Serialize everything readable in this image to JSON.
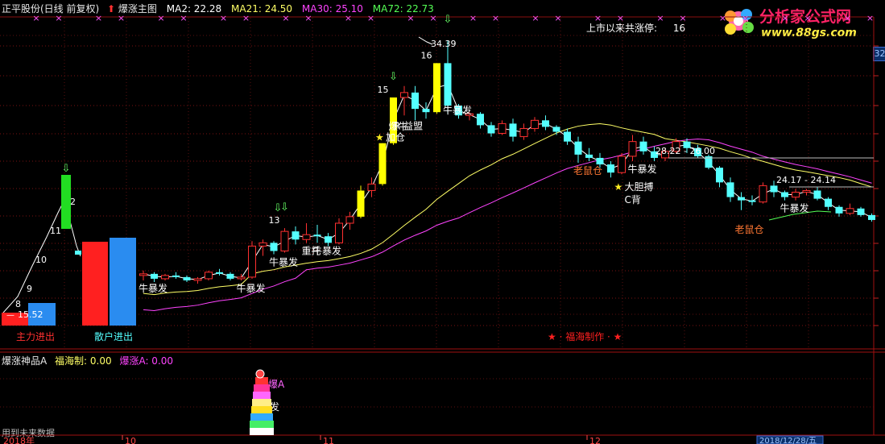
{
  "header": {
    "stock": "正平股份(日线 前复权)",
    "indicator": "爆涨主图",
    "ma": [
      {
        "label": "MA2: 22.28",
        "color": "#ffffff"
      },
      {
        "label": "MA21: 24.50",
        "color": "#ffff66"
      },
      {
        "label": "MA30: 25.10",
        "color": "#ff44ff"
      },
      {
        "label": "MA72: 22.73",
        "color": "#55ff55"
      }
    ]
  },
  "limit_up": {
    "label": "上市以来共涨停:",
    "value": "16"
  },
  "logo": {
    "title": "分析家公式网",
    "url": "www.88gs.com"
  },
  "right_axis": {
    "top_value": "32"
  },
  "sub": {
    "title": "爆涨神品A",
    "f1": "福海制: 0.00",
    "f2": "爆涨A: 0.00",
    "burst_label": "爆A",
    "fa_label": "发"
  },
  "bottom": {
    "future": "用到未来数据",
    "year": "2018年",
    "months": [
      "10",
      "11",
      "12"
    ],
    "date": "2018/12/28/五"
  },
  "chart_data": {
    "type": "candlestick",
    "candles": [
      [
        20.0,
        20.3,
        19.7,
        20.1
      ],
      [
        20.1,
        20.2,
        19.6,
        19.8
      ],
      [
        19.8,
        20.1,
        19.7,
        20.0
      ],
      [
        20.0,
        20.2,
        19.8,
        19.9
      ],
      [
        19.9,
        20.0,
        19.6,
        19.7
      ],
      [
        19.7,
        19.9,
        19.5,
        19.8
      ],
      [
        19.8,
        20.3,
        19.7,
        20.2
      ],
      [
        20.2,
        20.4,
        20.0,
        20.1
      ],
      [
        20.1,
        20.2,
        19.7,
        19.8
      ],
      [
        19.8,
        20.1,
        19.7,
        19.9
      ],
      [
        19.9,
        22.1,
        19.8,
        21.8
      ],
      [
        21.8,
        22.2,
        21.2,
        22.0
      ],
      [
        22.0,
        22.1,
        21.3,
        21.5
      ],
      [
        21.5,
        22.9,
        21.4,
        22.7
      ],
      [
        22.7,
        23.0,
        21.9,
        22.2
      ],
      [
        22.2,
        23.2,
        22.0,
        22.5
      ],
      [
        22.5,
        23.1,
        22.0,
        22.4
      ],
      [
        22.4,
        22.6,
        21.8,
        22.0
      ],
      [
        22.0,
        23.5,
        21.9,
        23.2
      ],
      [
        23.2,
        23.9,
        22.8,
        23.6
      ],
      [
        23.6,
        25.5,
        23.5,
        25.2
      ],
      [
        25.2,
        26.0,
        24.8,
        25.6
      ],
      [
        25.6,
        28.1,
        25.5,
        28.1
      ],
      [
        28.1,
        30.9,
        28.0,
        30.9
      ],
      [
        30.9,
        31.6,
        29.8,
        31.2
      ],
      [
        31.2,
        31.6,
        29.5,
        30.2
      ],
      [
        30.2,
        30.6,
        29.6,
        30.0
      ],
      [
        30.0,
        33.0,
        29.9,
        33.0
      ],
      [
        33.0,
        34.4,
        29.9,
        30.4
      ],
      [
        30.4,
        30.5,
        29.6,
        29.8
      ],
      [
        29.8,
        30.0,
        29.5,
        29.9
      ],
      [
        29.9,
        30.0,
        29.0,
        29.2
      ],
      [
        29.2,
        29.4,
        28.5,
        28.7
      ],
      [
        28.7,
        29.5,
        28.6,
        29.3
      ],
      [
        29.3,
        29.6,
        28.2,
        28.5
      ],
      [
        28.5,
        29.3,
        28.3,
        29.0
      ],
      [
        29.0,
        29.7,
        28.8,
        29.5
      ],
      [
        29.5,
        29.8,
        28.9,
        29.1
      ],
      [
        29.1,
        29.2,
        28.6,
        28.8
      ],
      [
        28.8,
        29.0,
        28.0,
        28.2
      ],
      [
        28.2,
        28.5,
        26.9,
        27.4
      ],
      [
        27.4,
        27.8,
        27.0,
        27.2
      ],
      [
        27.2,
        27.5,
        26.6,
        26.8
      ],
      [
        26.8,
        27.0,
        26.0,
        26.3
      ],
      [
        26.3,
        27.5,
        26.2,
        27.3
      ],
      [
        27.3,
        28.6,
        27.0,
        28.2
      ],
      [
        28.2,
        28.5,
        27.4,
        27.6
      ],
      [
        27.6,
        27.9,
        27.0,
        27.2
      ],
      [
        27.2,
        27.8,
        27.0,
        27.6
      ],
      [
        27.6,
        28.4,
        27.5,
        28.2
      ],
      [
        28.2,
        28.4,
        27.5,
        27.8
      ],
      [
        27.8,
        28.0,
        27.2,
        27.3
      ],
      [
        27.3,
        27.4,
        26.5,
        26.6
      ],
      [
        26.6,
        26.7,
        25.4,
        25.7
      ],
      [
        25.7,
        26.0,
        24.5,
        24.8
      ],
      [
        24.8,
        25.1,
        24.0,
        24.6
      ],
      [
        24.6,
        24.9,
        24.3,
        24.5
      ],
      [
        24.5,
        25.7,
        24.4,
        25.5
      ],
      [
        25.5,
        25.8,
        24.8,
        25.1
      ],
      [
        25.1,
        25.2,
        24.6,
        24.8
      ],
      [
        24.8,
        25.3,
        24.6,
        25.1
      ],
      [
        25.1,
        25.3,
        24.9,
        25.2
      ],
      [
        25.2,
        25.4,
        24.6,
        24.7
      ],
      [
        24.7,
        24.8,
        24.0,
        24.2
      ],
      [
        24.2,
        24.3,
        23.6,
        23.8
      ],
      [
        23.8,
        24.4,
        23.7,
        24.1
      ],
      [
        24.1,
        24.2,
        23.6,
        23.7
      ],
      [
        23.7,
        23.8,
        23.3,
        23.4
      ]
    ],
    "limit_up_numbers": [
      {
        "i": 13,
        "text": "13"
      },
      {
        "i": 23,
        "text": "15"
      },
      {
        "i": 27,
        "text": "16"
      }
    ],
    "labels": [
      {
        "i": 0,
        "text": "牛暴发",
        "color": "#ffffff",
        "pos": "below"
      },
      {
        "i": 9,
        "text": "牛暴发",
        "color": "#ffffff",
        "pos": "below"
      },
      {
        "i": 12,
        "text": "牛暴发",
        "color": "#ffffff",
        "pos": "below"
      },
      {
        "i": 16,
        "text": "牛暴发",
        "color": "#ffffff",
        "pos": "below"
      },
      {
        "i": 15,
        "text": "重托",
        "color": "#ffffff",
        "pos": "below"
      },
      {
        "i": 23,
        "text": "爆牛",
        "color": "#ffffff",
        "pos": "above"
      },
      {
        "i": 22,
        "text": "加仓",
        "color": "#ffffff",
        "pos": "belowstar"
      },
      {
        "i": 22,
        "text": "R 益盟",
        "color": "#ffffff",
        "pos": "mid"
      },
      {
        "i": 28,
        "text": "牛暴发",
        "color": "#ffffff",
        "pos": "belowclose"
      },
      {
        "i": 40,
        "text": "老鼠仓",
        "color": "#ff7733",
        "pos": "below"
      },
      {
        "i": 45,
        "text": "牛暴发",
        "color": "#ffffff",
        "pos": "below"
      },
      {
        "i": 45,
        "text": "大胆搏",
        "color": "#ffffff",
        "pos": "belowstar2"
      },
      {
        "i": 45,
        "text": "C背",
        "color": "#ffffff",
        "pos": "below3"
      },
      {
        "i": 55,
        "text": "老鼠仓",
        "color": "#ff7733",
        "pos": "below2"
      },
      {
        "i": 59,
        "text": "牛暴发",
        "color": "#ffffff",
        "pos": "below"
      }
    ],
    "price_notes": [
      {
        "text": "34.39"
      },
      {
        "text": "28.22 - 26.00"
      },
      {
        "text": "24.17 - 24.14"
      }
    ],
    "left_ladder": [
      "8",
      "9",
      "10",
      "11",
      "12"
    ],
    "left_value": "15.52",
    "bars": {
      "main_force": "主力进出",
      "retail": "散户进出"
    },
    "credit": "福海制作"
  }
}
